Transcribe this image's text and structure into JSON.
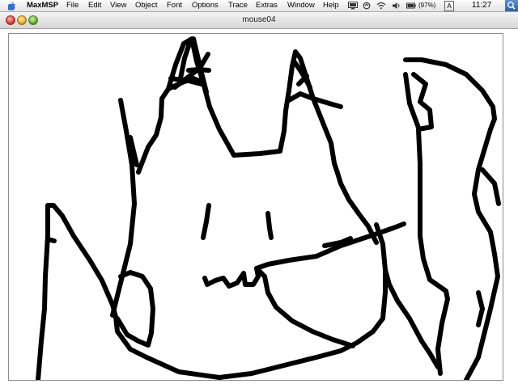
{
  "menubar": {
    "app_name": "MaxMSP",
    "items": [
      "File",
      "Edit",
      "View",
      "Object",
      "Font",
      "Options",
      "Trace",
      "Extras",
      "Window",
      "Help"
    ],
    "battery_percent": "(97%)",
    "input_menu": "A",
    "clock": "11:27"
  },
  "window": {
    "title": "mouse04"
  },
  "drawing": {
    "stroke_color": "#000000",
    "background": "#ffffff"
  }
}
